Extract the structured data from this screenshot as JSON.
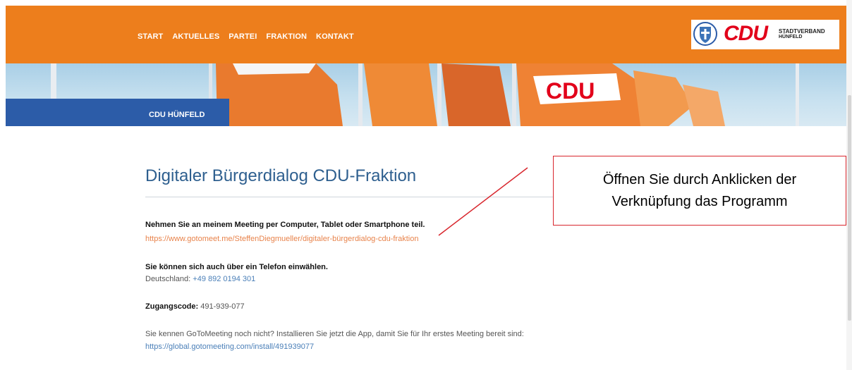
{
  "nav": {
    "items": [
      "START",
      "AKTUELLES",
      "PARTEI",
      "FRAKTION",
      "KONTAKT"
    ]
  },
  "logo": {
    "brand": "CDU",
    "sub_line1": "STADTVERBAND",
    "sub_line2": "HÜNFELD"
  },
  "banner": {
    "tag": "CDU HÜNFELD",
    "flag_text": "CDU"
  },
  "main": {
    "title": "Digitaler Bürgerdialog CDU-Fraktion",
    "meeting_intro": "Nehmen Sie an meinem Meeting per Computer, Tablet oder Smartphone teil.",
    "meeting_link": "https://www.gotomeet.me/SteffenDiegmueller/digitaler-bürgerdialog-cdu-fraktion",
    "phone_intro": "Sie können sich auch über ein Telefon einwählen.",
    "phone_country": "Deutschland:",
    "phone_number": "+49 892 0194 301",
    "code_label": "Zugangscode:",
    "code_value": "491-939-077",
    "install_text": "Sie kennen GoToMeeting noch nicht? Installieren Sie jetzt die App, damit Sie für Ihr erstes Meeting bereit sind:",
    "install_link": "https://global.gotomeeting.com/install/491939077"
  },
  "annotation": {
    "line1": "Öffnen Sie durch Anklicken der",
    "line2": "Verknüpfung das Programm"
  },
  "colors": {
    "header_orange": "#ed7e1c",
    "tag_blue": "#2c5ca8",
    "title_blue": "#2e5f8f",
    "link_orange": "#e8834b",
    "link_blue": "#4a7fb8",
    "annotation_red": "#d8262d"
  },
  "icons": [
    "shield-crest-icon"
  ]
}
